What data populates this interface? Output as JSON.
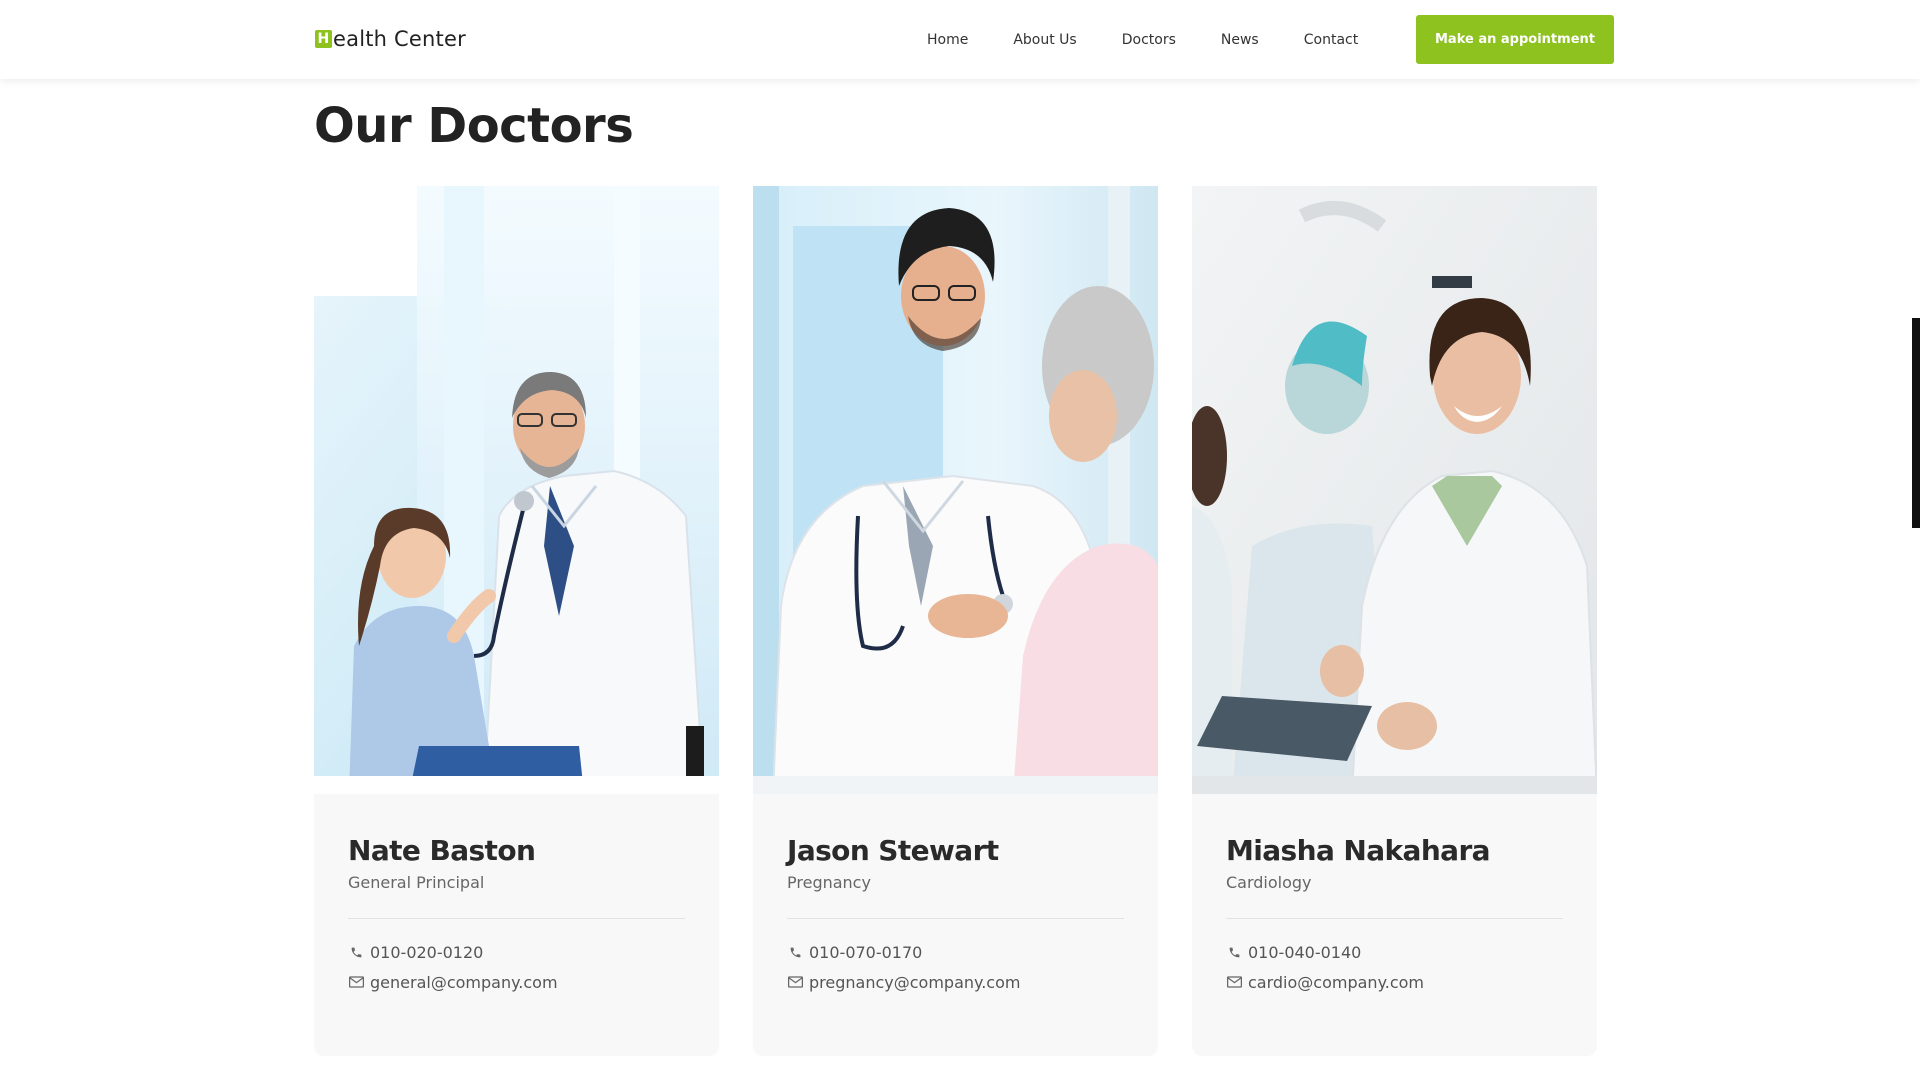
{
  "brand": {
    "mark": "H",
    "rest": "ealth Center"
  },
  "nav": {
    "items": [
      "Home",
      "About Us",
      "Doctors",
      "News",
      "Contact"
    ],
    "cta": "Make an appointment"
  },
  "section": {
    "title": "Our Doctors"
  },
  "doctors": [
    {
      "name": "Nate Baston",
      "role": "General Principal",
      "phone": "010-020-0120",
      "email": "general@company.com",
      "photo_icon": "doctor-with-child-photo"
    },
    {
      "name": "Jason Stewart",
      "role": "Pregnancy",
      "phone": "010-070-0170",
      "email": "pregnancy@company.com",
      "photo_icon": "doctor-with-patient-photo"
    },
    {
      "name": "Miasha Nakahara",
      "role": "Cardiology",
      "phone": "010-040-0140",
      "email": "cardio@company.com",
      "photo_icon": "female-doctor-photo"
    }
  ],
  "colors": {
    "accent": "#8dc21f",
    "card_bg": "#f8f8f8",
    "text_dark": "#222222",
    "text_muted": "#666666"
  }
}
